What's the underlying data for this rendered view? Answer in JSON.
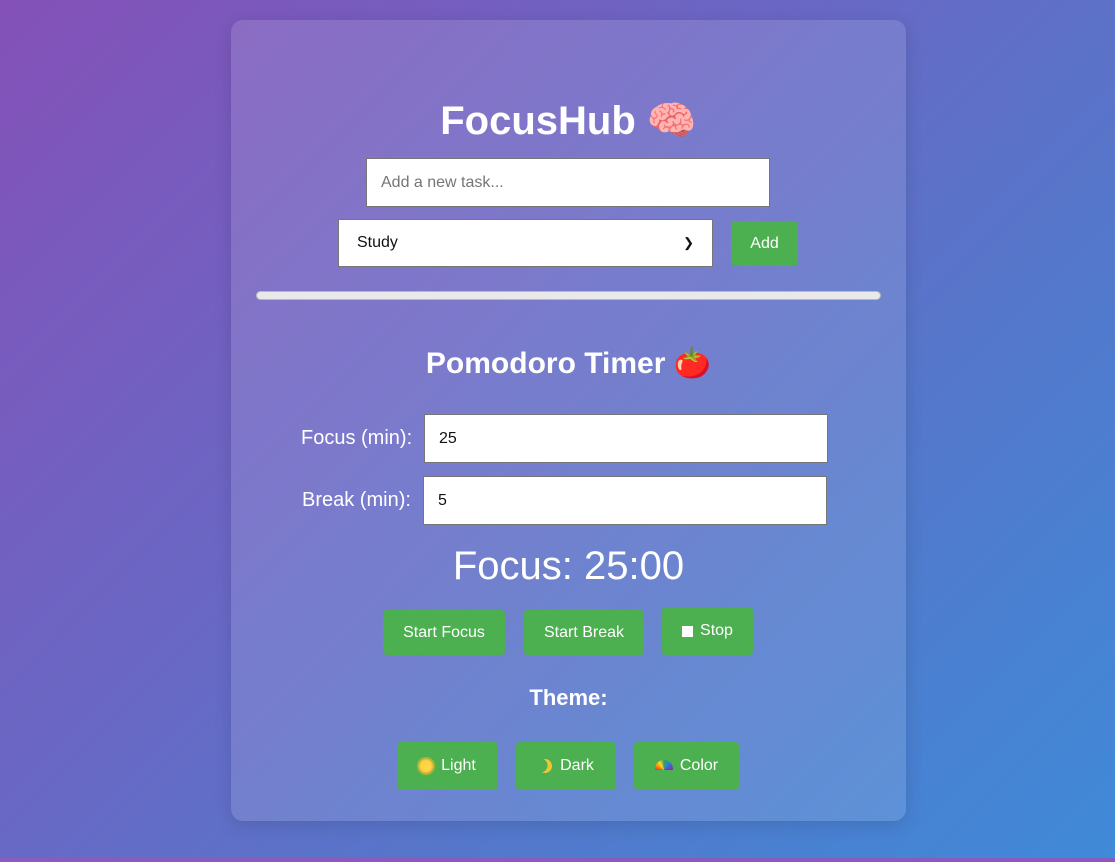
{
  "app": {
    "title": "FocusHub",
    "title_icon": "brain-icon"
  },
  "task_form": {
    "input_placeholder": "Add a new task...",
    "input_value": "",
    "category_selected": "Study",
    "add_label": "Add"
  },
  "progress": {
    "percent": 0
  },
  "pomodoro": {
    "heading": "Pomodoro Timer",
    "heading_icon": "tomato-icon",
    "focus_label": "Focus (min):",
    "focus_value": "25",
    "break_label": "Break (min):",
    "break_value": "5",
    "timer_display": "Focus: 25:00",
    "start_focus_label": "Start Focus",
    "start_break_label": "Start Break",
    "stop_label": "Stop",
    "stop_icon": "stop-square-icon"
  },
  "theme": {
    "label": "Theme:",
    "options": [
      {
        "label": "Light",
        "icon": "sun-icon"
      },
      {
        "label": "Dark",
        "icon": "crescent-moon-icon"
      },
      {
        "label": "Color",
        "icon": "rainbow-icon"
      }
    ]
  },
  "colors": {
    "accent_button": "#4caf50",
    "background_start": "#8451b8",
    "background_end": "#3f8ad8"
  }
}
